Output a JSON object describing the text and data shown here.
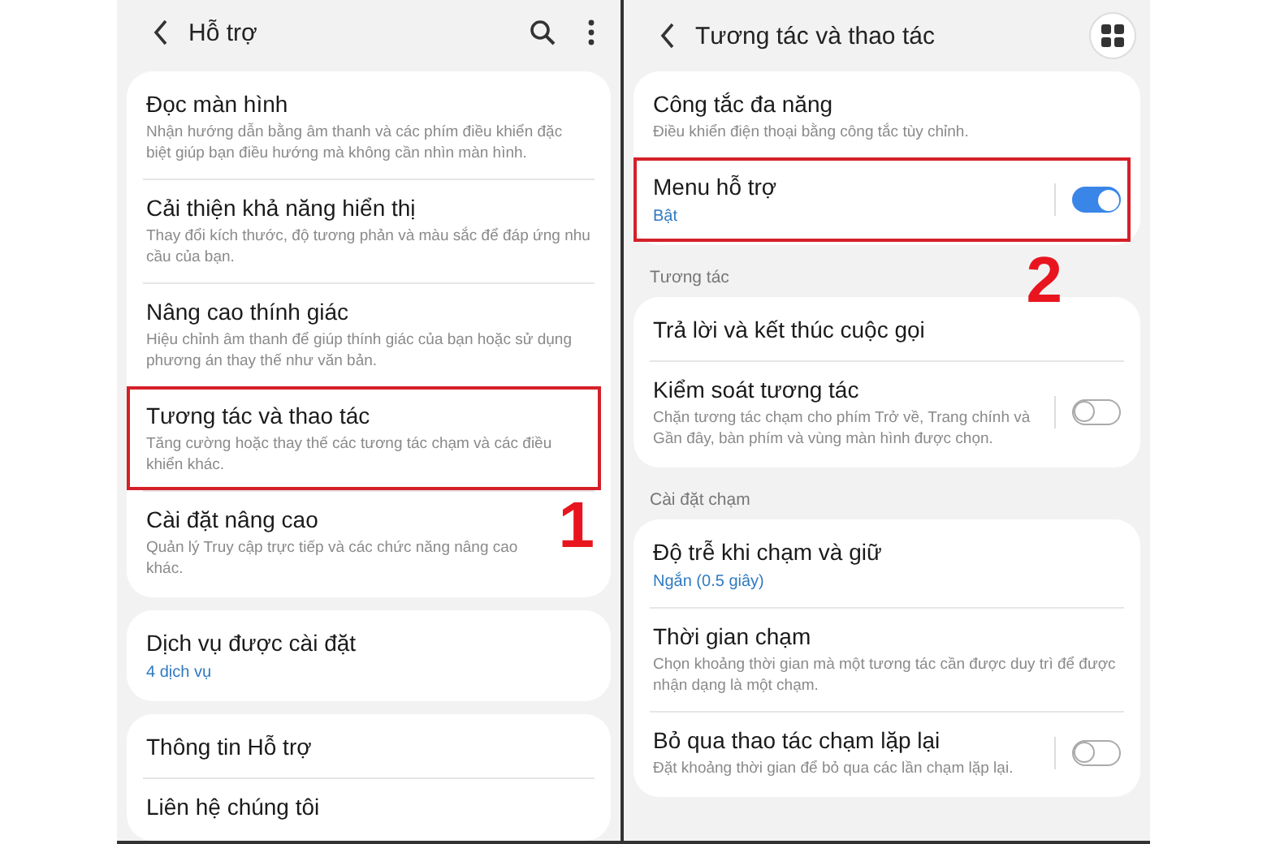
{
  "screens": [
    {
      "title": "Hỗ trợ",
      "actions": [
        {
          "kind": "search"
        },
        {
          "kind": "more"
        }
      ],
      "sections": [
        {
          "items": [
            {
              "title": "Đọc màn hình",
              "description": "Nhận hướng dẫn bằng âm thanh và các phím điều khiển đặc biệt giúp bạn điều hướng mà không cần nhìn màn hình."
            },
            {
              "title": "Cải thiện khả năng hiển thị",
              "description": "Thay đổi kích thước, độ tương phản và màu sắc để đáp ứng nhu cầu của bạn."
            },
            {
              "title": "Nâng cao thính giác",
              "description": "Hiệu chỉnh âm thanh để giúp thính giác của bạn hoặc sử dụng phương án thay thế như văn bản."
            },
            {
              "title": "Tương tác và thao tác",
              "description": "Tăng cường hoặc thay thế các tương tác chạm và các điều khiển khác.",
              "highlighted": true
            },
            {
              "title": "Cài đặt nâng cao",
              "description": "Quản lý Truy cập trực tiếp và các chức năng nâng cao khác.",
              "callout": "1"
            }
          ]
        },
        {
          "items": [
            {
              "title": "Dịch vụ được cài đặt",
              "value": "4 dịch vụ"
            }
          ]
        },
        {
          "items": [
            {
              "title": "Thông tin Hỗ trợ"
            },
            {
              "title": "Liên hệ chúng tôi"
            }
          ]
        }
      ]
    },
    {
      "title": "Tương tác và thao tác",
      "actions": [
        {
          "kind": "grid"
        }
      ],
      "sections": [
        {
          "items": [
            {
              "title": "Công tắc đa năng",
              "description": "Điều khiển điện thoại bằng công tắc tùy chỉnh."
            },
            {
              "title": "Menu hỗ trợ",
              "value": "Bật",
              "on": true,
              "highlighted": true,
              "callout": "2"
            }
          ]
        },
        {
          "header": "Tương tác",
          "items": [
            {
              "title": "Trả lời và kết thúc cuộc gọi"
            },
            {
              "title": "Kiểm soát tương tác",
              "description": "Chặn tương tác chạm cho phím Trở về, Trang chính và Gần đây, bàn phím và vùng màn hình được chọn.",
              "on": false
            }
          ]
        },
        {
          "header": "Cài đặt chạm",
          "items": [
            {
              "title": "Độ trễ khi chạm và giữ",
              "value": "Ngắn (0.5 giây)"
            },
            {
              "title": "Thời gian chạm",
              "description": "Chọn khoảng thời gian mà một tương tác cần được duy trì để được nhận dạng là một chạm."
            },
            {
              "title": "Bỏ qua thao tác chạm lặp lại",
              "description": "Đặt khoảng thời gian để bỏ qua các lần chạm lặp lại.",
              "on": false
            }
          ]
        }
      ]
    }
  ]
}
